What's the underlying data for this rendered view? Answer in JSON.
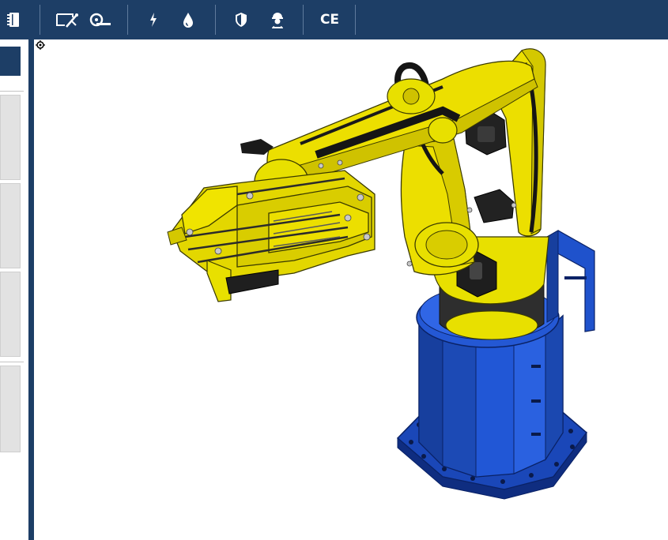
{
  "toolbar": {
    "buttons": [
      {
        "name": "notebook-icon",
        "label": ""
      },
      {
        "name": "measure-tool-icon",
        "label": ""
      },
      {
        "name": "tape-measure-icon",
        "label": ""
      },
      {
        "name": "electrical-icon",
        "label": ""
      },
      {
        "name": "fluid-icon",
        "label": ""
      },
      {
        "name": "safety-shield-icon",
        "label": ""
      },
      {
        "name": "operator-icon",
        "label": ""
      },
      {
        "name": "ce-mark-icon",
        "label": "CE"
      }
    ],
    "ce_label": "CE"
  },
  "viewport": {
    "model": "palletizing-robot",
    "base_color": "#1a47b8",
    "arm_color": "#e8e000",
    "origin_marker": "target-icon"
  },
  "colors": {
    "toolbar_bg": "#1d3e66",
    "panel_bg": "#e2e2e2"
  }
}
